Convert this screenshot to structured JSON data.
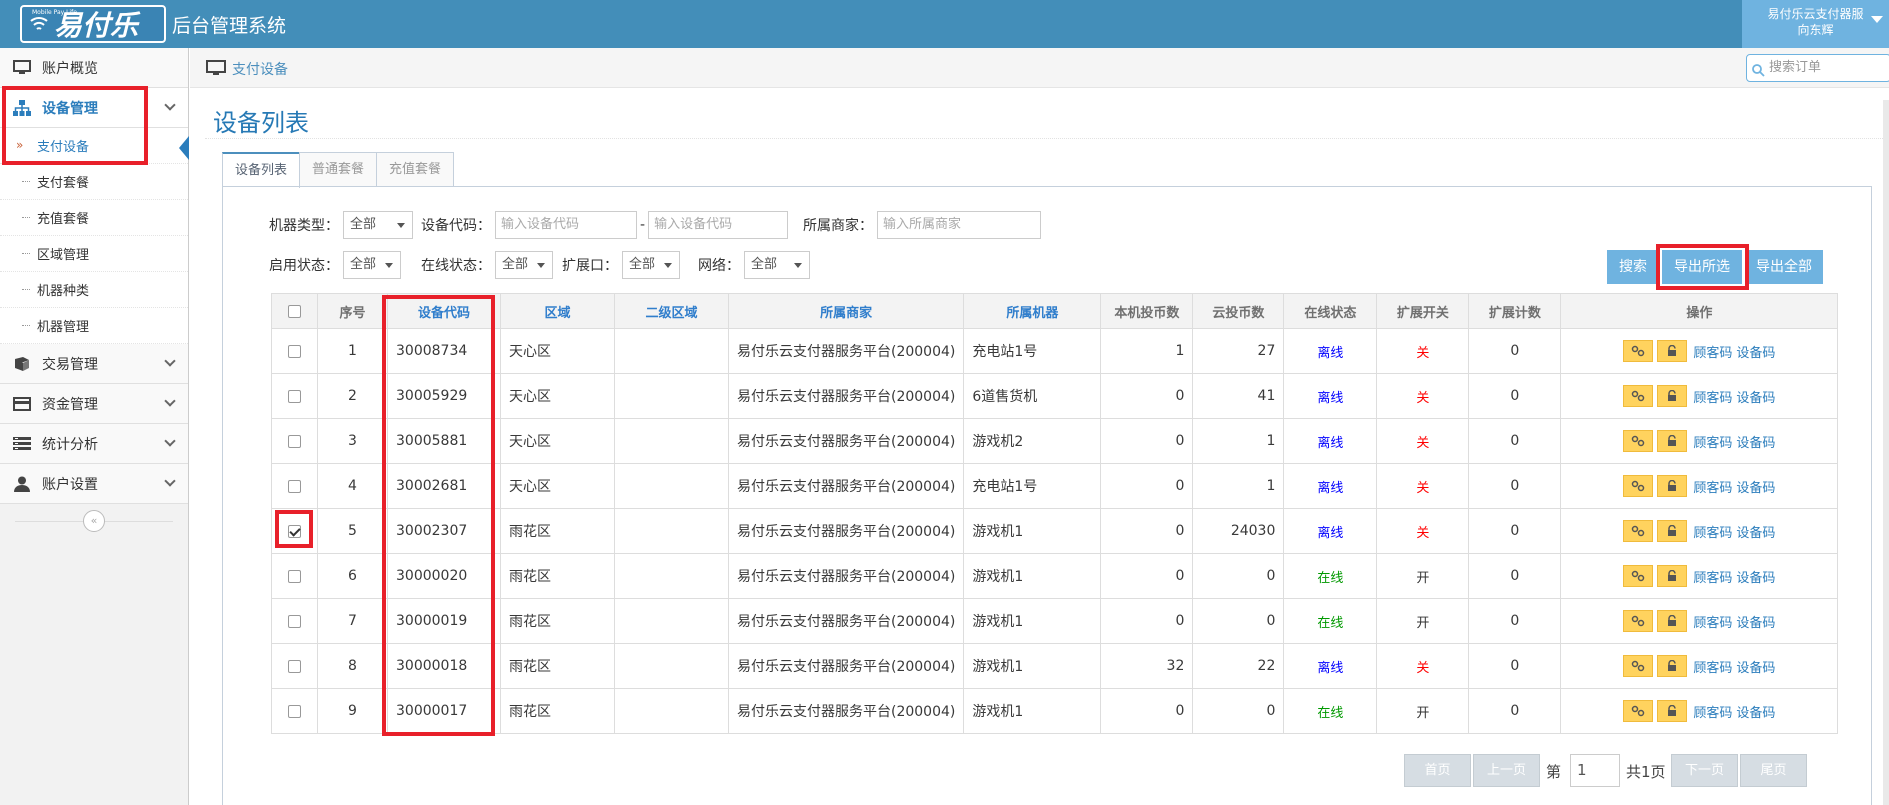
{
  "header": {
    "logo_tag": "Mobile Pay Life",
    "logo_text": "易付乐",
    "system_title": "后台管理系统",
    "user_company": "易付乐云支付器服",
    "user_name": "向东辉"
  },
  "sidebar": {
    "items": [
      {
        "label": "账户概览",
        "icon": "monitor-icon"
      },
      {
        "label": "设备管理",
        "icon": "sitemap-icon"
      },
      {
        "label": "交易管理",
        "icon": "book-icon"
      },
      {
        "label": "资金管理",
        "icon": "credit-card-icon"
      },
      {
        "label": "统计分析",
        "icon": "list-icon"
      },
      {
        "label": "账户设置",
        "icon": "user-icon"
      }
    ],
    "sub_items": [
      "支付设备",
      "支付套餐",
      "充值套餐",
      "区域管理",
      "机器种类",
      "机器管理"
    ],
    "active_marker": "»",
    "collapse_glyph": "«"
  },
  "breadcrumb": {
    "label": "支付设备"
  },
  "search": {
    "placeholder": "搜索订单"
  },
  "page": {
    "title": "设备列表"
  },
  "tabs": [
    "设备列表",
    "普通套餐",
    "充值套餐"
  ],
  "filters": {
    "machine_type_label": "机器类型：",
    "machine_type_value": "全部",
    "device_code_label": "设备代码：",
    "device_code_placeholder": "输入设备代码",
    "range_sep": "-",
    "merchant_label": "所属商家：",
    "merchant_placeholder": "输入所属商家",
    "enable_label": "启用状态：",
    "enable_value": "全部",
    "online_label": "在线状态：",
    "online_value": "全部",
    "port_label": "扩展口：",
    "port_value": "全部",
    "network_label": "网络：",
    "network_value": "全部"
  },
  "actions": {
    "search": "搜索",
    "export_selected": "导出所选",
    "export_all": "导出全部"
  },
  "table": {
    "headers": [
      "序号",
      "设备代码",
      "区域",
      "二级区域",
      "所属商家",
      "所属机器",
      "本机投币数",
      "云投币数",
      "在线状态",
      "扩展开关",
      "扩展计数",
      "操作"
    ],
    "link_customer": "顾客码",
    "link_device": "设备码",
    "rows": [
      {
        "no": "1",
        "code": "30008734",
        "area": "天心区",
        "sub": "",
        "merchant": "易付乐云支付器服务平台(200004)",
        "machine": "充电站1号",
        "local": "1",
        "cloud": "27",
        "status": "离线",
        "online": false,
        "switch": "关",
        "count": "0",
        "checked": false
      },
      {
        "no": "2",
        "code": "30005929",
        "area": "天心区",
        "sub": "",
        "merchant": "易付乐云支付器服务平台(200004)",
        "machine": "6道售货机",
        "local": "0",
        "cloud": "41",
        "status": "离线",
        "online": false,
        "switch": "关",
        "count": "0",
        "checked": false
      },
      {
        "no": "3",
        "code": "30005881",
        "area": "天心区",
        "sub": "",
        "merchant": "易付乐云支付器服务平台(200004)",
        "machine": "游戏机2",
        "local": "0",
        "cloud": "1",
        "status": "离线",
        "online": false,
        "switch": "关",
        "count": "0",
        "checked": false
      },
      {
        "no": "4",
        "code": "30002681",
        "area": "天心区",
        "sub": "",
        "merchant": "易付乐云支付器服务平台(200004)",
        "machine": "充电站1号",
        "local": "0",
        "cloud": "1",
        "status": "离线",
        "online": false,
        "switch": "关",
        "count": "0",
        "checked": false
      },
      {
        "no": "5",
        "code": "30002307",
        "area": "雨花区",
        "sub": "",
        "merchant": "易付乐云支付器服务平台(200004)",
        "machine": "游戏机1",
        "local": "0",
        "cloud": "24030",
        "status": "离线",
        "online": false,
        "switch": "关",
        "count": "0",
        "checked": true
      },
      {
        "no": "6",
        "code": "30000020",
        "area": "雨花区",
        "sub": "",
        "merchant": "易付乐云支付器服务平台(200004)",
        "machine": "游戏机1",
        "local": "0",
        "cloud": "0",
        "status": "在线",
        "online": true,
        "switch": "开",
        "count": "0",
        "checked": false
      },
      {
        "no": "7",
        "code": "30000019",
        "area": "雨花区",
        "sub": "",
        "merchant": "易付乐云支付器服务平台(200004)",
        "machine": "游戏机1",
        "local": "0",
        "cloud": "0",
        "status": "在线",
        "online": true,
        "switch": "开",
        "count": "0",
        "checked": false
      },
      {
        "no": "8",
        "code": "30000018",
        "area": "雨花区",
        "sub": "",
        "merchant": "易付乐云支付器服务平台(200004)",
        "machine": "游戏机1",
        "local": "32",
        "cloud": "22",
        "status": "离线",
        "online": false,
        "switch": "关",
        "count": "0",
        "checked": false
      },
      {
        "no": "9",
        "code": "30000017",
        "area": "雨花区",
        "sub": "",
        "merchant": "易付乐云支付器服务平台(200004)",
        "machine": "游戏机1",
        "local": "0",
        "cloud": "0",
        "status": "在线",
        "online": true,
        "switch": "开",
        "count": "0",
        "checked": false
      }
    ]
  },
  "pager": {
    "first": "首页",
    "prev": "上一页",
    "page_prefix": "第",
    "page_value": "1",
    "total": "共1页",
    "next": "下一页",
    "last": "尾页"
  }
}
